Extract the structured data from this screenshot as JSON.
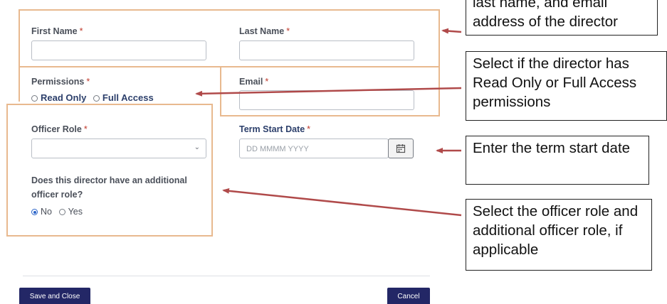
{
  "form": {
    "first_name_label": "First Name",
    "last_name_label": "Last Name",
    "permissions_label": "Permissions",
    "email_label": "Email",
    "permission_options": [
      "Read Only",
      "Full Access"
    ],
    "officer_role_label": "Officer Role",
    "term_start_label": "Term Start Date",
    "term_start_placeholder": "DD MMMM YYYY",
    "additional_role_question": "Does this director have an additional officer role?",
    "additional_role_options": [
      "No",
      "Yes"
    ],
    "additional_role_selected": "No",
    "required_marker": "*",
    "save_button": "Save and Close",
    "cancel_button": "Cancel"
  },
  "callouts": {
    "name_email": "last name, and email address of the director",
    "permissions": "Select if the director has Read Only or Full Access permissions",
    "term_start": "Enter the term start date",
    "officer_role": "Select the officer role and additional officer role, if applicable"
  },
  "colors": {
    "highlight_border": "#e8b98f",
    "arrow": "#b04a4a",
    "button_bg": "#232766",
    "radio_selected": "#2a64c8",
    "required": "#c0392b"
  }
}
